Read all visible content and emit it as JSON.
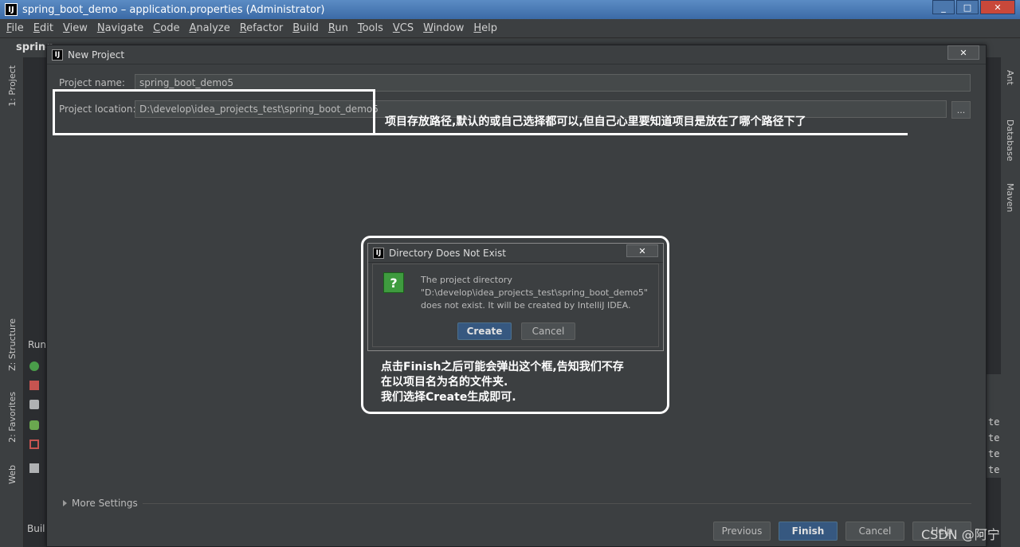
{
  "window": {
    "title": "spring_boot_demo – application.properties (Administrator)",
    "app_icon": "IJ",
    "minimize": "_",
    "maximize": "□",
    "close": "✕"
  },
  "menu": [
    "File",
    "Edit",
    "View",
    "Navigate",
    "Code",
    "Analyze",
    "Refactor",
    "Build",
    "Run",
    "Tools",
    "VCS",
    "Window",
    "Help"
  ],
  "ide": {
    "project_label": "spring",
    "left_tabs": {
      "project": "1: Project",
      "structure": "Z: Structure",
      "favorites": "2: Favorites",
      "web": "Web"
    },
    "right_tabs": {
      "ant": "Ant",
      "database": "Database",
      "maven": "Maven"
    },
    "run_label": "Run",
    "build_label": "Buil",
    "bg_lines": [
      "te",
      "te",
      "te",
      "te"
    ]
  },
  "new_project": {
    "title": "New Project",
    "project_name_label": "Project name:",
    "project_name_value": "spring_boot_demo5",
    "project_location_label": "Project location:",
    "project_location_value": "D:\\develop\\idea_projects_test\\spring_boot_demo5",
    "browse_label": "...",
    "more_settings": "More Settings",
    "buttons": {
      "previous": "Previous",
      "finish": "Finish",
      "cancel": "Cancel",
      "help": "Help"
    }
  },
  "annotation_location": "项目存放路径,默认的或自己选择都可以,但自己心里要知道项目是放在了哪个路径下了",
  "dir_dialog": {
    "title": "Directory Does Not Exist",
    "line1": "The project directory",
    "line2": "\"D:\\develop\\idea_projects_test\\spring_boot_demo5\"",
    "line3": "does not exist. It will be created by IntelliJ IDEA.",
    "create": "Create",
    "cancel": "Cancel",
    "close": "✕"
  },
  "annotation_dialog": {
    "line1": "点击Finish之后可能会弹出这个框,告知我们不存",
    "line2": "在以项目名为名的文件夹.",
    "line3": "我们选择Create生成即可."
  },
  "watermark": "CSDN @阿宁"
}
